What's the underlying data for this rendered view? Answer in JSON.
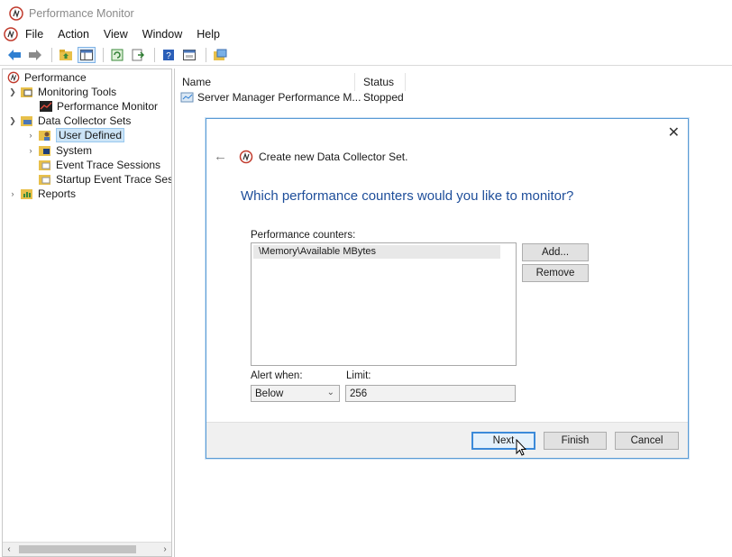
{
  "window": {
    "title": "Performance Monitor"
  },
  "menu": [
    "File",
    "Action",
    "View",
    "Window",
    "Help"
  ],
  "tree": {
    "items": [
      {
        "label": "Performance",
        "level": 0,
        "expand": ""
      },
      {
        "label": "Monitoring Tools",
        "level": 1,
        "expand": "open"
      },
      {
        "label": "Performance Monitor",
        "level": 2,
        "expand": ""
      },
      {
        "label": "Data Collector Sets",
        "level": 1,
        "expand": "open"
      },
      {
        "label": "User Defined",
        "level": 2,
        "expand": "closed",
        "selected": true
      },
      {
        "label": "System",
        "level": 2,
        "expand": "closed"
      },
      {
        "label": "Event Trace Sessions",
        "level": 2,
        "expand": ""
      },
      {
        "label": "Startup Event Trace Ses",
        "level": 2,
        "expand": ""
      },
      {
        "label": "Reports",
        "level": 1,
        "expand": "closed"
      }
    ]
  },
  "list": {
    "columns": [
      "Name",
      "Status"
    ],
    "rows": [
      {
        "name": "Server Manager Performance M...",
        "status": "Stopped"
      }
    ]
  },
  "dialog": {
    "wizard_title": "Create new Data Collector Set.",
    "question": "Which performance counters would you like to monitor?",
    "counters_label": "Performance counters:",
    "counters": [
      "\\Memory\\Available MBytes"
    ],
    "add_label": "Add...",
    "remove_label": "Remove",
    "alert_label": "Alert when:",
    "alert_value": "Below",
    "limit_label": "Limit:",
    "limit_value": "256",
    "next_label": "Next",
    "finish_label": "Finish",
    "cancel_label": "Cancel"
  },
  "colors": {
    "accent": "#1e4e9a",
    "dialog_border": "#5a9bd5",
    "selection": "#cce4f7"
  }
}
